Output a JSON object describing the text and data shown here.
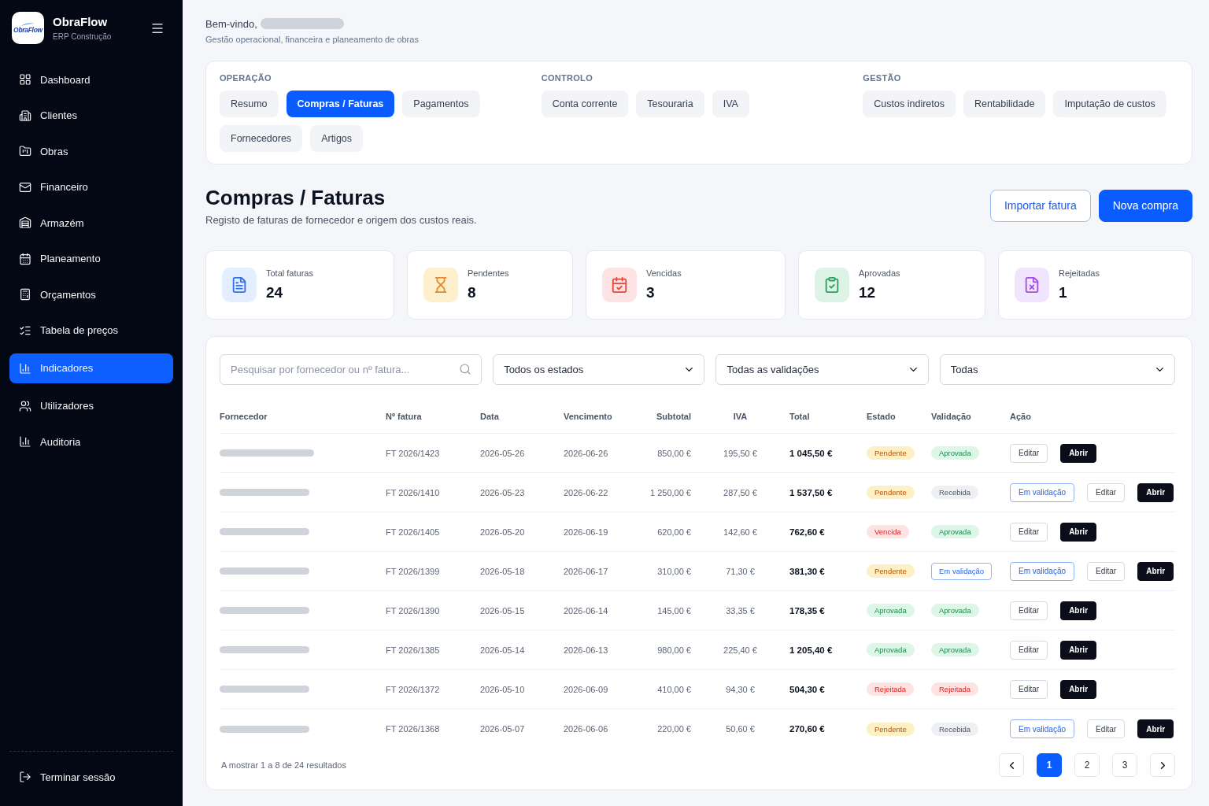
{
  "sidebar": {
    "brand": {
      "logo_text": "ObraFlow",
      "name": "ObraFlow",
      "subtitle": "ERP Construção"
    },
    "items": [
      {
        "label": "Dashboard",
        "selected": false
      },
      {
        "label": "Clientes",
        "selected": false
      },
      {
        "label": "Obras",
        "selected": false
      },
      {
        "label": "Financeiro",
        "selected": false
      },
      {
        "label": "Armazém",
        "selected": false
      },
      {
        "label": "Planeamento",
        "selected": false
      },
      {
        "label": "Orçamentos",
        "selected": false
      },
      {
        "label": "Tabela de preços",
        "selected": false
      },
      {
        "label": "Indicadores",
        "selected": true
      },
      {
        "label": "Utilizadores",
        "selected": false
      },
      {
        "label": "Auditoria",
        "selected": false
      }
    ],
    "logout": "Terminar sessão"
  },
  "header": {
    "greeting": "Bem-vindo,",
    "tagline": "Gestão operacional, financeira e planeamento de obras"
  },
  "module_tabs": [
    {
      "group": "OPERAÇÃO",
      "tabs": [
        {
          "label": "Resumo",
          "selected": false
        },
        {
          "label": "Compras / Faturas",
          "selected": true
        },
        {
          "label": "Pagamentos",
          "selected": false
        },
        {
          "label": "Fornecedores",
          "selected": false
        },
        {
          "label": "Artigos",
          "selected": false
        }
      ]
    },
    {
      "group": "CONTROLO",
      "tabs": [
        {
          "label": "Conta corrente",
          "selected": false
        },
        {
          "label": "Tesouraria",
          "selected": false
        },
        {
          "label": "IVA",
          "selected": false
        }
      ]
    },
    {
      "group": "GESTÃO",
      "tabs": [
        {
          "label": "Custos indiretos",
          "selected": false
        },
        {
          "label": "Rentabilidade",
          "selected": false
        },
        {
          "label": "Imputação de custos",
          "selected": false
        }
      ]
    }
  ],
  "page": {
    "title": "Compras / Faturas",
    "subtitle": "Registo de faturas de fornecedor e origem dos custos reais.",
    "buttons": [
      {
        "label": "Importar fatura",
        "kind": "secondary"
      },
      {
        "label": "Nova compra",
        "kind": "primary"
      }
    ]
  },
  "stats": [
    {
      "label": "Total faturas",
      "value": "24",
      "kind": "total"
    },
    {
      "label": "Pendentes",
      "value": "8",
      "kind": "pending"
    },
    {
      "label": "Vencidas",
      "value": "3",
      "kind": "overdue"
    },
    {
      "label": "Aprovadas",
      "value": "12",
      "kind": "approved"
    },
    {
      "label": "Rejeitadas",
      "value": "1",
      "kind": "rejected"
    }
  ],
  "filters": {
    "search": {
      "placeholder": "Pesquisar por fornecedor ou nº fatura..."
    },
    "selects": [
      {
        "value": "Todos os estados"
      },
      {
        "value": "Todas as validações"
      },
      {
        "value": "Todas"
      }
    ]
  },
  "table": {
    "columns": [
      "Fornecedor",
      "Nº fatura",
      "Data",
      "Vencimento",
      "Subtotal",
      "IVA",
      "Total",
      "Estado",
      "Validação",
      "Ação"
    ],
    "rows": [
      {
        "invoice": "FT 2026/1423",
        "date": "2026-05-26",
        "due": "2026-06-26",
        "subtotal": "850,00 €",
        "vat": "195,50 €",
        "total": "1 045,50 €",
        "status": {
          "label": "Pendente",
          "kind": "pending"
        },
        "validation": {
          "label": "Aprovada",
          "kind": "approved"
        },
        "actions": [
          {
            "label": "Editar",
            "kind": "edit"
          },
          {
            "label": "Abrir",
            "kind": "open"
          }
        ]
      },
      {
        "invoice": "FT 2026/1410",
        "date": "2026-05-23",
        "due": "2026-06-22",
        "subtotal": "1 250,00 €",
        "vat": "287,50 €",
        "total": "1 537,50 €",
        "status": {
          "label": "Pendente",
          "kind": "pending"
        },
        "validation": {
          "label": "Recebida",
          "kind": "received"
        },
        "actions": [
          {
            "label": "Em validação",
            "kind": "review"
          },
          {
            "label": "Editar",
            "kind": "edit"
          },
          {
            "label": "Abrir",
            "kind": "open"
          }
        ]
      },
      {
        "invoice": "FT 2026/1405",
        "date": "2026-05-20",
        "due": "2026-06-19",
        "subtotal": "620,00 €",
        "vat": "142,60 €",
        "total": "762,60 €",
        "status": {
          "label": "Vencida",
          "kind": "overdue"
        },
        "validation": {
          "label": "Aprovada",
          "kind": "approved"
        },
        "actions": [
          {
            "label": "Editar",
            "kind": "edit"
          },
          {
            "label": "Abrir",
            "kind": "open"
          }
        ]
      },
      {
        "invoice": "FT 2026/1399",
        "date": "2026-05-18",
        "due": "2026-06-17",
        "subtotal": "310,00 €",
        "vat": "71,30 €",
        "total": "381,30 €",
        "status": {
          "label": "Pendente",
          "kind": "pending"
        },
        "validation": {
          "label": "Em validação",
          "kind": "in_review"
        },
        "actions": [
          {
            "label": "Em validação",
            "kind": "review"
          },
          {
            "label": "Editar",
            "kind": "edit"
          },
          {
            "label": "Abrir",
            "kind": "open"
          }
        ]
      },
      {
        "invoice": "FT 2026/1390",
        "date": "2026-05-15",
        "due": "2026-06-14",
        "subtotal": "145,00 €",
        "vat": "33,35 €",
        "total": "178,35 €",
        "status": {
          "label": "Aprovada",
          "kind": "approved"
        },
        "validation": {
          "label": "Aprovada",
          "kind": "approved"
        },
        "actions": [
          {
            "label": "Editar",
            "kind": "edit"
          },
          {
            "label": "Abrir",
            "kind": "open"
          }
        ]
      },
      {
        "invoice": "FT 2026/1385",
        "date": "2026-05-14",
        "due": "2026-06-13",
        "subtotal": "980,00 €",
        "vat": "225,40 €",
        "total": "1 205,40 €",
        "status": {
          "label": "Aprovada",
          "kind": "approved"
        },
        "validation": {
          "label": "Aprovada",
          "kind": "approved"
        },
        "actions": [
          {
            "label": "Editar",
            "kind": "edit"
          },
          {
            "label": "Abrir",
            "kind": "open"
          }
        ]
      },
      {
        "invoice": "FT 2026/1372",
        "date": "2026-05-10",
        "due": "2026-06-09",
        "subtotal": "410,00 €",
        "vat": "94,30 €",
        "total": "504,30 €",
        "status": {
          "label": "Rejeitada",
          "kind": "rejected"
        },
        "validation": {
          "label": "Rejeitada",
          "kind": "rejected"
        },
        "actions": [
          {
            "label": "Editar",
            "kind": "edit"
          },
          {
            "label": "Abrir",
            "kind": "open"
          }
        ]
      },
      {
        "invoice": "FT 2026/1368",
        "date": "2026-05-07",
        "due": "2026-06-06",
        "subtotal": "220,00 €",
        "vat": "50,60 €",
        "total": "270,60 €",
        "status": {
          "label": "Pendente",
          "kind": "pending"
        },
        "validation": {
          "label": "Recebida",
          "kind": "received"
        },
        "actions": [
          {
            "label": "Em validação",
            "kind": "review"
          },
          {
            "label": "Editar",
            "kind": "edit"
          },
          {
            "label": "Abrir",
            "kind": "open"
          }
        ]
      }
    ]
  },
  "pagination": {
    "summary": "A mostrar 1 a 8 de 24 resultados",
    "pages": [
      {
        "label": "1",
        "selected": true
      },
      {
        "label": "2",
        "selected": false
      },
      {
        "label": "3",
        "selected": false
      }
    ]
  }
}
